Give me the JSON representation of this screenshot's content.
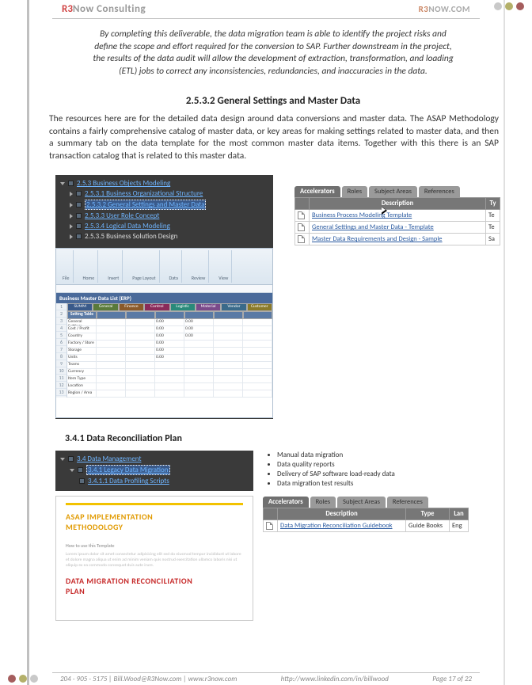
{
  "header": {
    "brand_prefix": "R3",
    "brand_suffix": "Now Consulting",
    "site_prefix": "R3",
    "site_suffix": "NOW.COM"
  },
  "dots": {
    "c1": "#c9c9c9",
    "c2": "#b4b06a",
    "c3": "#a55d5d"
  },
  "intro": "By completing this deliverable, the data migration team is able to identify the project risks and define the scope and effort required for the conversion to SAP. Further downstream in the project, the results of the data audit will allow the development of extraction, transformation, and loading (ETL) jobs to correct any inconsistencies, redundancies, and inaccuracies in the data.",
  "sec2532": {
    "heading": "2.5.3.2 General Settings and Master Data",
    "body": "The resources here are for the detailed data design around data conversions and master data.  The ASAP Methodology contains a fairly comprehensive catalog of master data, or key areas for making settings related to master data, and then a summary tab on the data template for the most common master data items.  Together with this there is an SAP transaction catalog that is related to this master data."
  },
  "tree1": {
    "root": "2.5.3  Business Objects Modeling",
    "items": [
      "2.5.3.1  Business Organizational Structure",
      "2.5.3.2  General Settings and Master Data",
      "2.5.3.3  User Role Concept",
      "2.5.3.4  Logical Data Modeling",
      "2.5.3.5  Business Solution Design"
    ],
    "selected_index": 1
  },
  "tabs1": {
    "items": [
      "Accelerators",
      "Roles",
      "Subject Areas",
      "References"
    ],
    "active_index": 0
  },
  "table1": {
    "cols": [
      "",
      "Description",
      "Ty"
    ],
    "rows": [
      {
        "desc": "Business Process Modeling Template",
        "type": "Te"
      },
      {
        "desc": "General Settings and Master Data - Template",
        "type": "Te"
      },
      {
        "desc": "Master Data Requirements and Design - Sample",
        "type": "Sa"
      }
    ]
  },
  "excel": {
    "ribbon_groups": [
      "File",
      "Home",
      "Insert",
      "Page Layout",
      "Data",
      "Review",
      "View"
    ],
    "title": "Business Master Data List (ERP)",
    "col_tabs": [
      "SUMM",
      "General",
      "Finance",
      "Control",
      "Logistic",
      "Material",
      "Vendor",
      "Customer"
    ],
    "tab_colors": [
      "#3a5a8a",
      "#5a7a3a",
      "#8a5a2a",
      "#8a2a5a",
      "#2a8a7a",
      "#7a4a8a",
      "#3a6a8a",
      "#8a7a2a"
    ],
    "header_row": [
      "Setting Table",
      "",
      "",
      "",
      "",
      "",
      ""
    ],
    "rows": [
      [
        "General Settings",
        "",
        "",
        "0.00",
        "0.00",
        "",
        ""
      ],
      [
        "Cost / Profit",
        "",
        "",
        "0.00",
        "0.00",
        "",
        ""
      ],
      [
        "Country",
        "",
        "",
        "0.00",
        "0.00",
        "",
        ""
      ],
      [
        "Factory / Store",
        "",
        "",
        "0.00",
        "",
        "",
        ""
      ],
      [
        "Storage",
        "",
        "",
        "0.00",
        "",
        "",
        ""
      ],
      [
        "Units",
        "",
        "",
        "0.00",
        "",
        "",
        ""
      ],
      [
        "Teams",
        "",
        "",
        "",
        "",
        "",
        ""
      ],
      [
        "Currency",
        "",
        "",
        "",
        "",
        "",
        ""
      ],
      [
        "Item Type",
        "",
        "",
        "",
        "",
        "",
        ""
      ],
      [
        "Location",
        "",
        "",
        "",
        "",
        "",
        ""
      ],
      [
        "Region / Area",
        "",
        "",
        "",
        "",
        "",
        ""
      ]
    ]
  },
  "sec341": {
    "heading": "3.4.1 Data Reconciliation Plan"
  },
  "tree2": {
    "root": "3.4  Data Management",
    "child": "3.4.1  Legacy Data Migration",
    "leaf": "3.4.1.1  Data Profiling Scripts"
  },
  "bullets2": [
    "Manual data migration",
    "Data quality reports",
    "Delivery of SAP software load-ready data",
    "Data migration test results"
  ],
  "tabs2": {
    "items": [
      "Accelerators",
      "Roles",
      "Subject Areas",
      "References"
    ],
    "active_index": 0
  },
  "table2": {
    "cols": [
      "",
      "Description",
      "Type",
      "Lan"
    ],
    "rows": [
      {
        "desc": "Data Migration Reconciliation Guidebook",
        "type": "Guide Books",
        "lang": "Eng"
      }
    ]
  },
  "doc_thumb": {
    "title_a": "ASAP IMPLEMENTATION",
    "title_b": "METHODOLOGY",
    "howto": "How to use this Template",
    "title2_a": "DATA MIGRATION RECONCILIATION",
    "title2_b": "PLAN"
  },
  "footer": {
    "left": "204 - 905 - 5175   |   Bill.Wood@R3Now.com   |   www.r3now.com",
    "center": "http://www.linkedin.com/in/billwood",
    "right": "Page 17 of 22"
  }
}
